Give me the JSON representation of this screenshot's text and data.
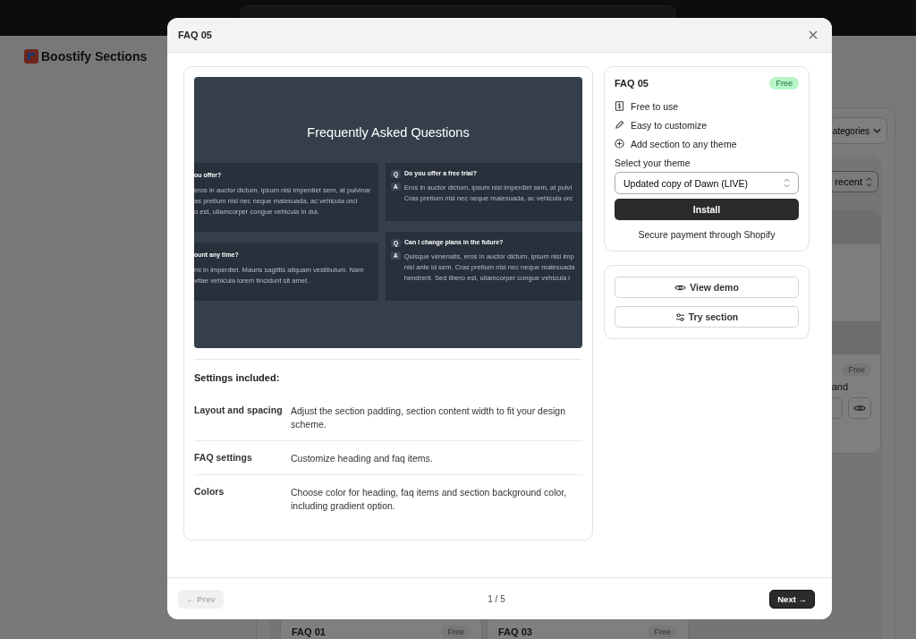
{
  "page": {
    "logo": "Boostify Sections",
    "category_filter": "ategories",
    "sort": "recent",
    "side_card": {
      "badge": "Free",
      "description": "and"
    },
    "cards": [
      {
        "title": "FAQ 01",
        "badge": "Free"
      },
      {
        "title": "FAQ 03",
        "badge": "Free"
      }
    ]
  },
  "modal": {
    "title": "FAQ 05",
    "preview": {
      "heading": "Frequently Asked Questions",
      "left_items": [
        {
          "question": "ou offer?",
          "answer": [
            "eros in auctor dictum, ipsum nisi imperdiet sem, at pulvinar",
            "as pretium nisi nec neque malesuada, ac vehicula orci",
            "o est, ullamcorper congue vehicula in dui."
          ]
        },
        {
          "question": "ount any time?",
          "answer": [
            "mi in imperdiet. Mauris sagittis aliquam vestibulum. Nam",
            "vitae vehicula lorem tincidunt sit amet."
          ]
        }
      ],
      "right_items": [
        {
          "q_mark": "Q",
          "a_mark": "A",
          "question": "Do you offer a free trial?",
          "answer": [
            "Eros in auctor dictum, ipsum nisi imperdiet sem, at pulvi",
            "Cras pretium nisi nec neque malesuada, ac vehicula orc"
          ]
        },
        {
          "q_mark": "Q",
          "a_mark": "A",
          "question": "Can I change plans in the future?",
          "answer": [
            "Quisque venenatis, eros in auctor dictum, ipsum nisi imp",
            "nisi ante id sem. Cras pretium nisi nec neque malesuada",
            "hendrerit. Sed libero est, ullamcorper congue vehicula i"
          ]
        }
      ]
    },
    "settings_title": "Settings included:",
    "settings": [
      {
        "name": "Layout and spacing",
        "description": "Adjust the section padding, section content width to fit your design scheme."
      },
      {
        "name": "FAQ settings",
        "description": "Customize heading and faq items."
      },
      {
        "name": "Colors",
        "description": "Choose color for heading, faq items and section background color, including gradient option."
      }
    ],
    "info": {
      "title": "FAQ 05",
      "badge": "Free",
      "features": [
        {
          "kind": "receipt",
          "label": "Free to use"
        },
        {
          "kind": "pencil",
          "label": "Easy to customize"
        },
        {
          "kind": "plus",
          "label": "Add section to any theme"
        }
      ],
      "theme_label": "Select your theme",
      "theme_value": "Updated copy of Dawn (LIVE)",
      "install": "Install",
      "note": "Secure payment through Shopify"
    },
    "actions": [
      {
        "kind": "eye",
        "label": "View demo"
      },
      {
        "kind": "sliders",
        "label": "Try section"
      }
    ],
    "footer": {
      "prev": {
        "label": "← Prev",
        "disabled": true
      },
      "pager": "1 / 5",
      "next": {
        "label": "Next →",
        "disabled": false
      }
    }
  }
}
